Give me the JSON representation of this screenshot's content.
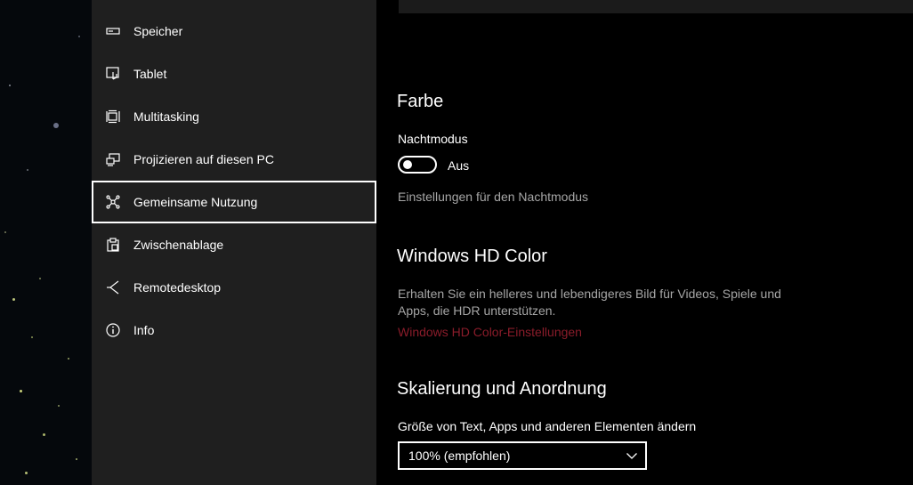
{
  "sidebar": {
    "items": [
      {
        "label": "Speicher",
        "icon": "storage-icon"
      },
      {
        "label": "Tablet",
        "icon": "tablet-icon"
      },
      {
        "label": "Multitasking",
        "icon": "multitasking-icon"
      },
      {
        "label": "Projizieren auf diesen PC",
        "icon": "project-icon"
      },
      {
        "label": "Gemeinsame Nutzung",
        "icon": "share-icon",
        "selected": true
      },
      {
        "label": "Zwischenablage",
        "icon": "clipboard-icon"
      },
      {
        "label": "Remotedesktop",
        "icon": "remote-desktop-icon"
      },
      {
        "label": "Info",
        "icon": "info-icon"
      }
    ]
  },
  "main": {
    "color_section": {
      "title": "Farbe",
      "night_mode_label": "Nachtmodus",
      "night_mode_state": "Aus",
      "night_mode_on": false,
      "night_mode_settings_text": "Einstellungen für den Nachtmodus"
    },
    "hd_color_section": {
      "title": "Windows HD Color",
      "description_line1": "Erhalten Sie ein helleres und lebendigeres Bild für Videos, Spiele und",
      "description_line2": "Apps, die HDR unterstützen.",
      "link": "Windows HD Color-Einstellungen"
    },
    "scale_section": {
      "title": "Skalierung und Anordnung",
      "size_label": "Größe von Text, Apps und anderen Elementen ändern",
      "size_value": "100% (empfohlen)"
    }
  },
  "colors": {
    "sidebar_bg": "#1f1f1f",
    "main_bg": "#000000",
    "muted_text": "#a6a6a6",
    "link": "#8a1c2a"
  }
}
